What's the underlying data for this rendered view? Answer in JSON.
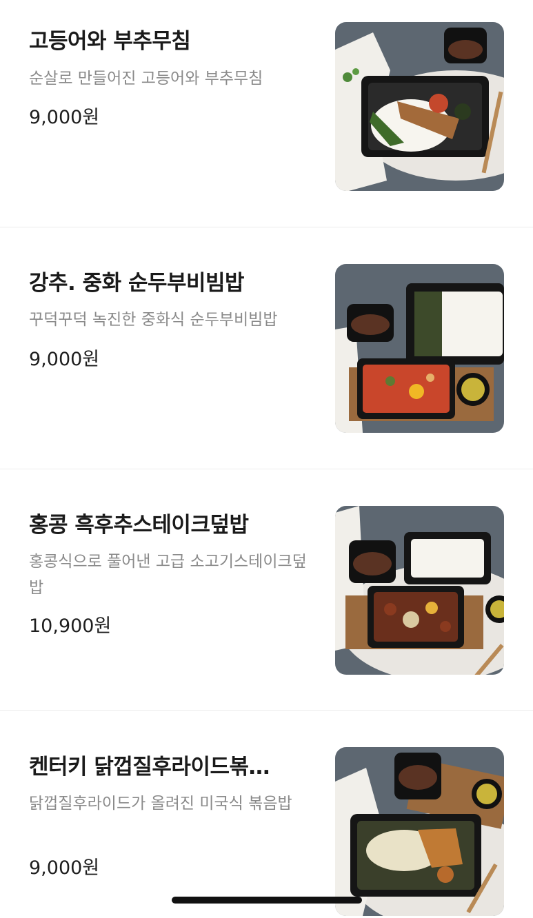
{
  "menu_items": [
    {
      "title": "고등어와 부추무침",
      "description": "순살로 만들어진 고등어와 부추무침",
      "price": "9,000원"
    },
    {
      "title": "강추. 중화 순두부비빔밥",
      "description": "꾸덕꾸덕 녹진한 중화식 순두부비빔밥",
      "price": "9,000원"
    },
    {
      "title": "홍콩 흑후추스테이크덮밥",
      "description": "홍콩식으로 풀어낸 고급 소고기스테이크덮밥",
      "price": "10,900원"
    },
    {
      "title": "켄터키 닭껍질후라이드볶…",
      "description": "닭껍질후라이드가 올려진 미국식 볶음밥",
      "price": "9,000원"
    }
  ]
}
